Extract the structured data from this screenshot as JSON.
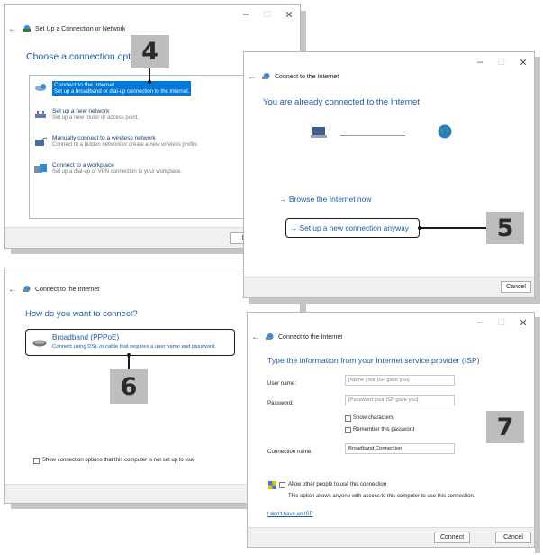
{
  "w1": {
    "title": "Set Up a Connection or Network",
    "heading": "Choose a connection option",
    "options": [
      {
        "title": "Connect to the Internet",
        "desc": "Set up a broadband or dial-up connection to the Internet."
      },
      {
        "title": "Set up a new network",
        "desc": "Set up a new router or access point."
      },
      {
        "title": "Manually connect to a wireless network",
        "desc": "Connect to a hidden network or create a new wireless profile."
      },
      {
        "title": "Connect to a workplace",
        "desc": "Set up a dial-up or VPN connection to your workplace."
      }
    ],
    "next": "Nex",
    "step": "4"
  },
  "w2": {
    "title": "Connect to the Internet",
    "heading": "You are already connected to the Internet",
    "browse": "→ Browse the Internet now",
    "setup": "→ Set up a new connection anyway",
    "cancel": "Cancel",
    "step": "5"
  },
  "w3": {
    "title": "Connect to the Internet",
    "heading": "How do you want to connect?",
    "option_title": "Broadband (PPPoE)",
    "option_desc": "Connect using DSL or cable that requires a user name and password.",
    "show_options": "Show connection options that this computer is not set up to use",
    "step": "6"
  },
  "w4": {
    "title": "Connect to the Internet",
    "heading": "Type the information from your Internet service provider (ISP)",
    "username_label": "User name:",
    "username_placeholder": "[Name your ISP gave you]",
    "password_label": "Password:",
    "password_placeholder": "[Password your ISP gave you]",
    "show_chars": "Show characters",
    "remember": "Remember this password",
    "conn_label": "Connection name:",
    "conn_value": "Broadband Connection",
    "allow": "Allow other people to use this connection",
    "allow_desc": "This option allows anyone with access to this computer to use this connection.",
    "no_isp": "I don't have an ISP",
    "connect": "Connect",
    "cancel": "Cancel",
    "step": "7"
  },
  "colors": {
    "accent": "#1c5aa6",
    "selection": "#0078d7",
    "step_box": "#bdbdbd"
  }
}
